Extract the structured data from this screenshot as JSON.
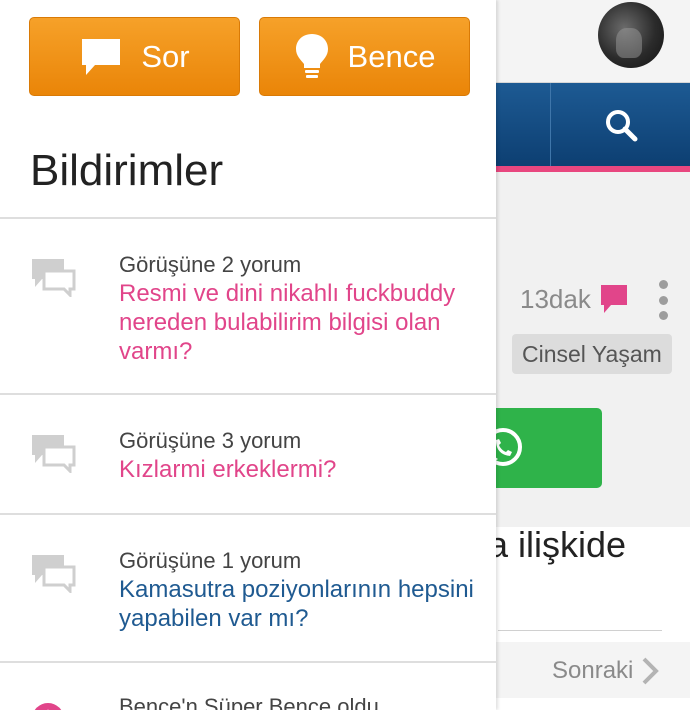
{
  "background_page": {
    "time_ago": "13dak",
    "category": "Cinsel Yaşam",
    "snippet": "la ilişkide",
    "next_label": "Sonraki",
    "colors": {
      "navbar": "#0d3f72",
      "accent": "#e8477f",
      "whatsapp": "#2fb34a"
    }
  },
  "drawer": {
    "ask_label": "Sor",
    "idea_label": "Bence",
    "title": "Bildirimler",
    "notifications": [
      {
        "line1": "Görüşüne 2 yorum",
        "line2": "Resmi ve dini nikahlı fuckbuddy nereden bulabilirim bilgisi olan varmı?",
        "color": "pink",
        "icon": "comments-icon"
      },
      {
        "line1": "Görüşüne 3 yorum",
        "line2": "Kızlarmi erkeklermi?",
        "color": "pink",
        "icon": "comments-icon"
      },
      {
        "line1": "Görüşüne 1 yorum",
        "line2": "Kamasutra poziyonlarının hepsini yapabilen var mı?",
        "color": "blue",
        "icon": "comments-icon"
      },
      {
        "line1": "Bence'n Süper Bence oldu",
        "icon": "super-badge-icon"
      }
    ],
    "colors": {
      "button": "#f39a1e",
      "pink_text": "#e1458a",
      "blue_text": "#1f5a91"
    }
  }
}
